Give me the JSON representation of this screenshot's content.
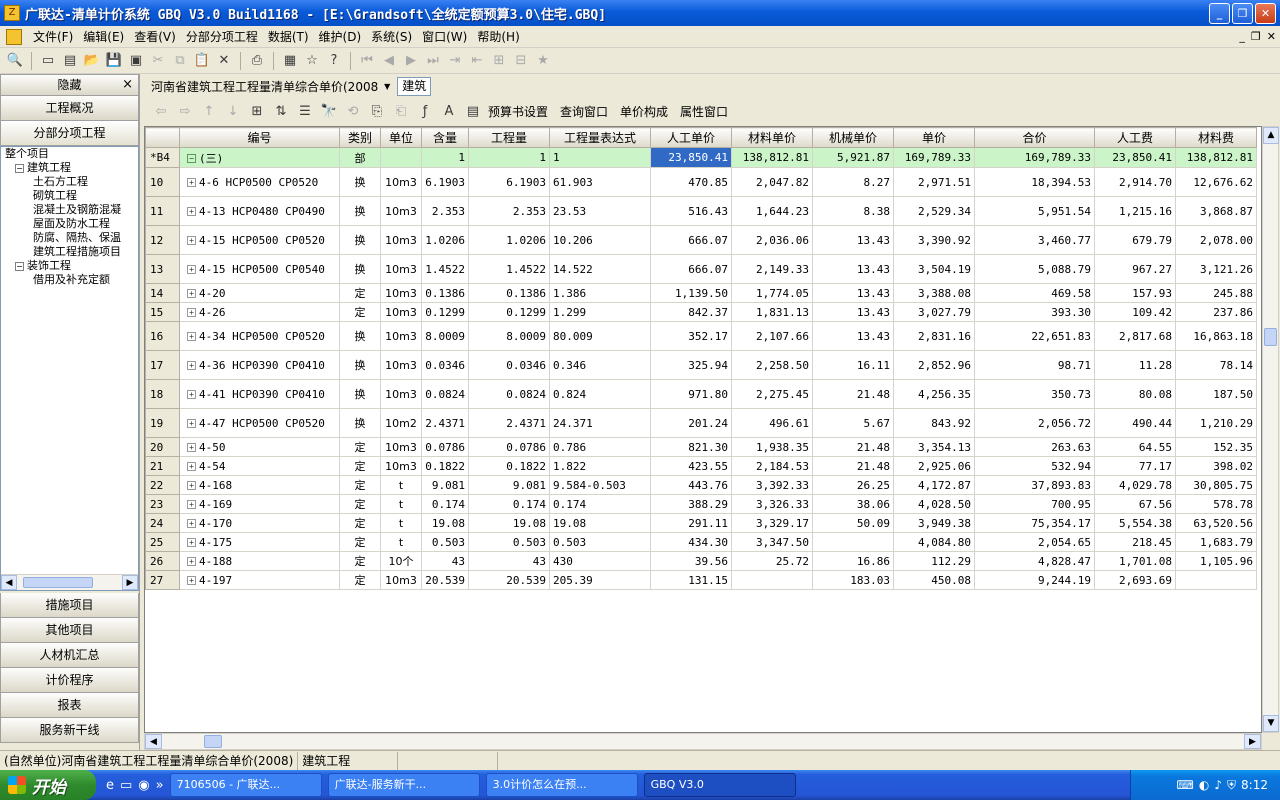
{
  "window": {
    "title": "广联达-清单计价系统 GBQ V3.0 Build1168 - [E:\\Grandsoft\\全统定额预算3.0\\住宅.GBQ]",
    "app_icon_glyph": "Z",
    "controls": {
      "minimize": "_",
      "restore": "❐",
      "close": "✕"
    }
  },
  "menu": {
    "items": [
      "文件(F)",
      "编辑(E)",
      "查看(V)",
      "分部分项工程",
      "数据(T)",
      "维护(D)",
      "系统(S)",
      "窗口(W)",
      "帮助(H)"
    ],
    "mdi": {
      "minimize": "_",
      "restore": "❐",
      "close": "✕"
    }
  },
  "toolbar": {
    "icons": [
      "print-preview-icon",
      "new-icon",
      "new-from-template-icon",
      "open-icon",
      "save-icon",
      "save-all-icon",
      "cut-icon",
      "copy-icon",
      "paste-icon",
      "delete-icon",
      "print-icon",
      "calculator-icon",
      "favorite-icon",
      "help-icon",
      "first-icon",
      "prev-icon",
      "next-icon",
      "last-icon",
      "indent-icon",
      "outdent-icon",
      "tree-icon",
      "collapse-icon",
      "bookmark-icon"
    ]
  },
  "left_panel": {
    "header": "隐藏",
    "close_glyph": "×",
    "top_buttons": [
      "工程概况",
      "分部分项工程"
    ],
    "tree": [
      {
        "label": "整个项目",
        "level": 0,
        "toggle": ""
      },
      {
        "label": "建筑工程",
        "level": 1,
        "toggle": "−"
      },
      {
        "label": "土石方工程",
        "level": 2,
        "toggle": ""
      },
      {
        "label": "砌筑工程",
        "level": 2,
        "toggle": ""
      },
      {
        "label": "混凝土及钢筋混凝",
        "level": 2,
        "toggle": ""
      },
      {
        "label": "屋面及防水工程",
        "level": 2,
        "toggle": ""
      },
      {
        "label": "防腐、隔热、保温",
        "level": 2,
        "toggle": ""
      },
      {
        "label": "建筑工程措施项目",
        "level": 2,
        "toggle": ""
      },
      {
        "label": "装饰工程",
        "level": 1,
        "toggle": "−"
      },
      {
        "label": "借用及补充定额",
        "level": 2,
        "toggle": ""
      }
    ],
    "bottom_buttons": [
      "措施项目",
      "其他项目",
      "人材机汇总",
      "计价程序",
      "报表",
      "服务新干线"
    ]
  },
  "content_header": {
    "dropdown": "河南省建筑工程工程量清单综合单价(2008",
    "tag": "建筑"
  },
  "content_toolbar": {
    "actions": [
      "预算书设置",
      "查询窗口",
      "单价构成",
      "属性窗口"
    ]
  },
  "grid": {
    "columns": [
      "",
      "编号",
      "类别",
      "单位",
      "含量",
      "工程量",
      "工程量表达式",
      "人工单价",
      "材料单价",
      "机械单价",
      "单价",
      "合价",
      "人工费",
      "材料费"
    ],
    "rows": [
      {
        "rownum": "*B4",
        "code": "(三)",
        "type": "部",
        "unit": "",
        "content": "1",
        "qty": "1",
        "expr": "1",
        "labor_price": "23,850.41",
        "material_price": "138,812.81",
        "machine_price": "5,921.87",
        "unit_price": "169,789.33",
        "total": "169,789.33",
        "labor_fee": "23,850.41",
        "material_fee": "138,812.81",
        "selected": true,
        "h": 20
      },
      {
        "rownum": "10",
        "code": "4-6 HCP0500 CP0520",
        "type": "换",
        "unit": "10m3",
        "content": "6.1903",
        "qty": "6.1903",
        "expr": "61.903",
        "labor_price": "470.85",
        "material_price": "2,047.82",
        "machine_price": "8.27",
        "unit_price": "2,971.51",
        "total": "18,394.53",
        "labor_fee": "2,914.70",
        "material_fee": "12,676.62",
        "h": 29
      },
      {
        "rownum": "11",
        "code": "4-13 HCP0480 CP0490",
        "type": "换",
        "unit": "10m3",
        "content": "2.353",
        "qty": "2.353",
        "expr": "23.53",
        "labor_price": "516.43",
        "material_price": "1,644.23",
        "machine_price": "8.38",
        "unit_price": "2,529.34",
        "total": "5,951.54",
        "labor_fee": "1,215.16",
        "material_fee": "3,868.87",
        "h": 29
      },
      {
        "rownum": "12",
        "code": "4-15 HCP0500 CP0520",
        "type": "换",
        "unit": "10m3",
        "content": "1.0206",
        "qty": "1.0206",
        "expr": "10.206",
        "labor_price": "666.07",
        "material_price": "2,036.06",
        "machine_price": "13.43",
        "unit_price": "3,390.92",
        "total": "3,460.77",
        "labor_fee": "679.79",
        "material_fee": "2,078.00",
        "h": 29
      },
      {
        "rownum": "13",
        "code": "4-15 HCP0500 CP0540",
        "type": "换",
        "unit": "10m3",
        "content": "1.4522",
        "qty": "1.4522",
        "expr": "14.522",
        "labor_price": "666.07",
        "material_price": "2,149.33",
        "machine_price": "13.43",
        "unit_price": "3,504.19",
        "total": "5,088.79",
        "labor_fee": "967.27",
        "material_fee": "3,121.26",
        "h": 29
      },
      {
        "rownum": "14",
        "code": "4-20",
        "type": "定",
        "unit": "10m3",
        "content": "0.1386",
        "qty": "0.1386",
        "expr": "1.386",
        "labor_price": "1,139.50",
        "material_price": "1,774.05",
        "machine_price": "13.43",
        "unit_price": "3,388.08",
        "total": "469.58",
        "labor_fee": "157.93",
        "material_fee": "245.88",
        "h": 19
      },
      {
        "rownum": "15",
        "code": "4-26",
        "type": "定",
        "unit": "10m3",
        "content": "0.1299",
        "qty": "0.1299",
        "expr": "1.299",
        "labor_price": "842.37",
        "material_price": "1,831.13",
        "machine_price": "13.43",
        "unit_price": "3,027.79",
        "total": "393.30",
        "labor_fee": "109.42",
        "material_fee": "237.86",
        "h": 19
      },
      {
        "rownum": "16",
        "code": "4-34 HCP0500 CP0520",
        "type": "换",
        "unit": "10m3",
        "content": "8.0009",
        "qty": "8.0009",
        "expr": "80.009",
        "labor_price": "352.17",
        "material_price": "2,107.66",
        "machine_price": "13.43",
        "unit_price": "2,831.16",
        "total": "22,651.83",
        "labor_fee": "2,817.68",
        "material_fee": "16,863.18",
        "h": 29
      },
      {
        "rownum": "17",
        "code": "4-36 HCP0390 CP0410",
        "type": "换",
        "unit": "10m3",
        "content": "0.0346",
        "qty": "0.0346",
        "expr": "0.346",
        "labor_price": "325.94",
        "material_price": "2,258.50",
        "machine_price": "16.11",
        "unit_price": "2,852.96",
        "total": "98.71",
        "labor_fee": "11.28",
        "material_fee": "78.14",
        "h": 29
      },
      {
        "rownum": "18",
        "code": "4-41 HCP0390 CP0410",
        "type": "换",
        "unit": "10m3",
        "content": "0.0824",
        "qty": "0.0824",
        "expr": "0.824",
        "labor_price": "971.80",
        "material_price": "2,275.45",
        "machine_price": "21.48",
        "unit_price": "4,256.35",
        "total": "350.73",
        "labor_fee": "80.08",
        "material_fee": "187.50",
        "h": 29
      },
      {
        "rownum": "19",
        "code": "4-47 HCP0500 CP0520",
        "type": "换",
        "unit": "10m2",
        "content": "2.4371",
        "qty": "2.4371",
        "expr": "24.371",
        "labor_price": "201.24",
        "material_price": "496.61",
        "machine_price": "5.67",
        "unit_price": "843.92",
        "total": "2,056.72",
        "labor_fee": "490.44",
        "material_fee": "1,210.29",
        "h": 29
      },
      {
        "rownum": "20",
        "code": "4-50",
        "type": "定",
        "unit": "10m3",
        "content": "0.0786",
        "qty": "0.0786",
        "expr": "0.786",
        "labor_price": "821.30",
        "material_price": "1,938.35",
        "machine_price": "21.48",
        "unit_price": "3,354.13",
        "total": "263.63",
        "labor_fee": "64.55",
        "material_fee": "152.35",
        "h": 19
      },
      {
        "rownum": "21",
        "code": "4-54",
        "type": "定",
        "unit": "10m3",
        "content": "0.1822",
        "qty": "0.1822",
        "expr": "1.822",
        "labor_price": "423.55",
        "material_price": "2,184.53",
        "machine_price": "21.48",
        "unit_price": "2,925.06",
        "total": "532.94",
        "labor_fee": "77.17",
        "material_fee": "398.02",
        "h": 19
      },
      {
        "rownum": "22",
        "code": "4-168",
        "type": "定",
        "unit": "t",
        "content": "9.081",
        "qty": "9.081",
        "expr": "9.584-0.503",
        "labor_price": "443.76",
        "material_price": "3,392.33",
        "machine_price": "26.25",
        "unit_price": "4,172.87",
        "total": "37,893.83",
        "labor_fee": "4,029.78",
        "material_fee": "30,805.75",
        "h": 19
      },
      {
        "rownum": "23",
        "code": "4-169",
        "type": "定",
        "unit": "t",
        "content": "0.174",
        "qty": "0.174",
        "expr": "0.174",
        "labor_price": "388.29",
        "material_price": "3,326.33",
        "machine_price": "38.06",
        "unit_price": "4,028.50",
        "total": "700.95",
        "labor_fee": "67.56",
        "material_fee": "578.78",
        "h": 19
      },
      {
        "rownum": "24",
        "code": "4-170",
        "type": "定",
        "unit": "t",
        "content": "19.08",
        "qty": "19.08",
        "expr": "19.08",
        "labor_price": "291.11",
        "material_price": "3,329.17",
        "machine_price": "50.09",
        "unit_price": "3,949.38",
        "total": "75,354.17",
        "labor_fee": "5,554.38",
        "material_fee": "63,520.56",
        "h": 19
      },
      {
        "rownum": "25",
        "code": "4-175",
        "type": "定",
        "unit": "t",
        "content": "0.503",
        "qty": "0.503",
        "expr": "0.503",
        "labor_price": "434.30",
        "material_price": "3,347.50",
        "machine_price": "",
        "unit_price": "4,084.80",
        "total": "2,054.65",
        "labor_fee": "218.45",
        "material_fee": "1,683.79",
        "h": 19
      },
      {
        "rownum": "26",
        "code": "4-188",
        "type": "定",
        "unit": "10个",
        "content": "43",
        "qty": "43",
        "expr": "430",
        "labor_price": "39.56",
        "material_price": "25.72",
        "machine_price": "16.86",
        "unit_price": "112.29",
        "total": "4,828.47",
        "labor_fee": "1,701.08",
        "material_fee": "1,105.96",
        "h": 19
      },
      {
        "rownum": "27",
        "code": "4-197",
        "type": "定",
        "unit": "10m3",
        "content": "20.539",
        "qty": "20.539",
        "expr": "205.39",
        "labor_price": "131.15",
        "material_price": "",
        "machine_price": "183.03",
        "unit_price": "450.08",
        "total": "9,244.19",
        "labor_fee": "2,693.69",
        "material_fee": "",
        "h": 19
      }
    ]
  },
  "statusbar": {
    "cells": [
      "(自然单位)河南省建筑工程工程量清单综合单价(2008)",
      "建筑工程",
      ""
    ]
  },
  "taskbar": {
    "start": "开始",
    "tasks": [
      {
        "label": "7106506 - 广联达...",
        "active": false
      },
      {
        "label": "广联达-服务新干...",
        "active": false
      },
      {
        "label": "3.0计价怎么在预...",
        "active": false
      },
      {
        "label": "GBQ V3.0",
        "active": true
      }
    ],
    "clock": "8:12"
  }
}
